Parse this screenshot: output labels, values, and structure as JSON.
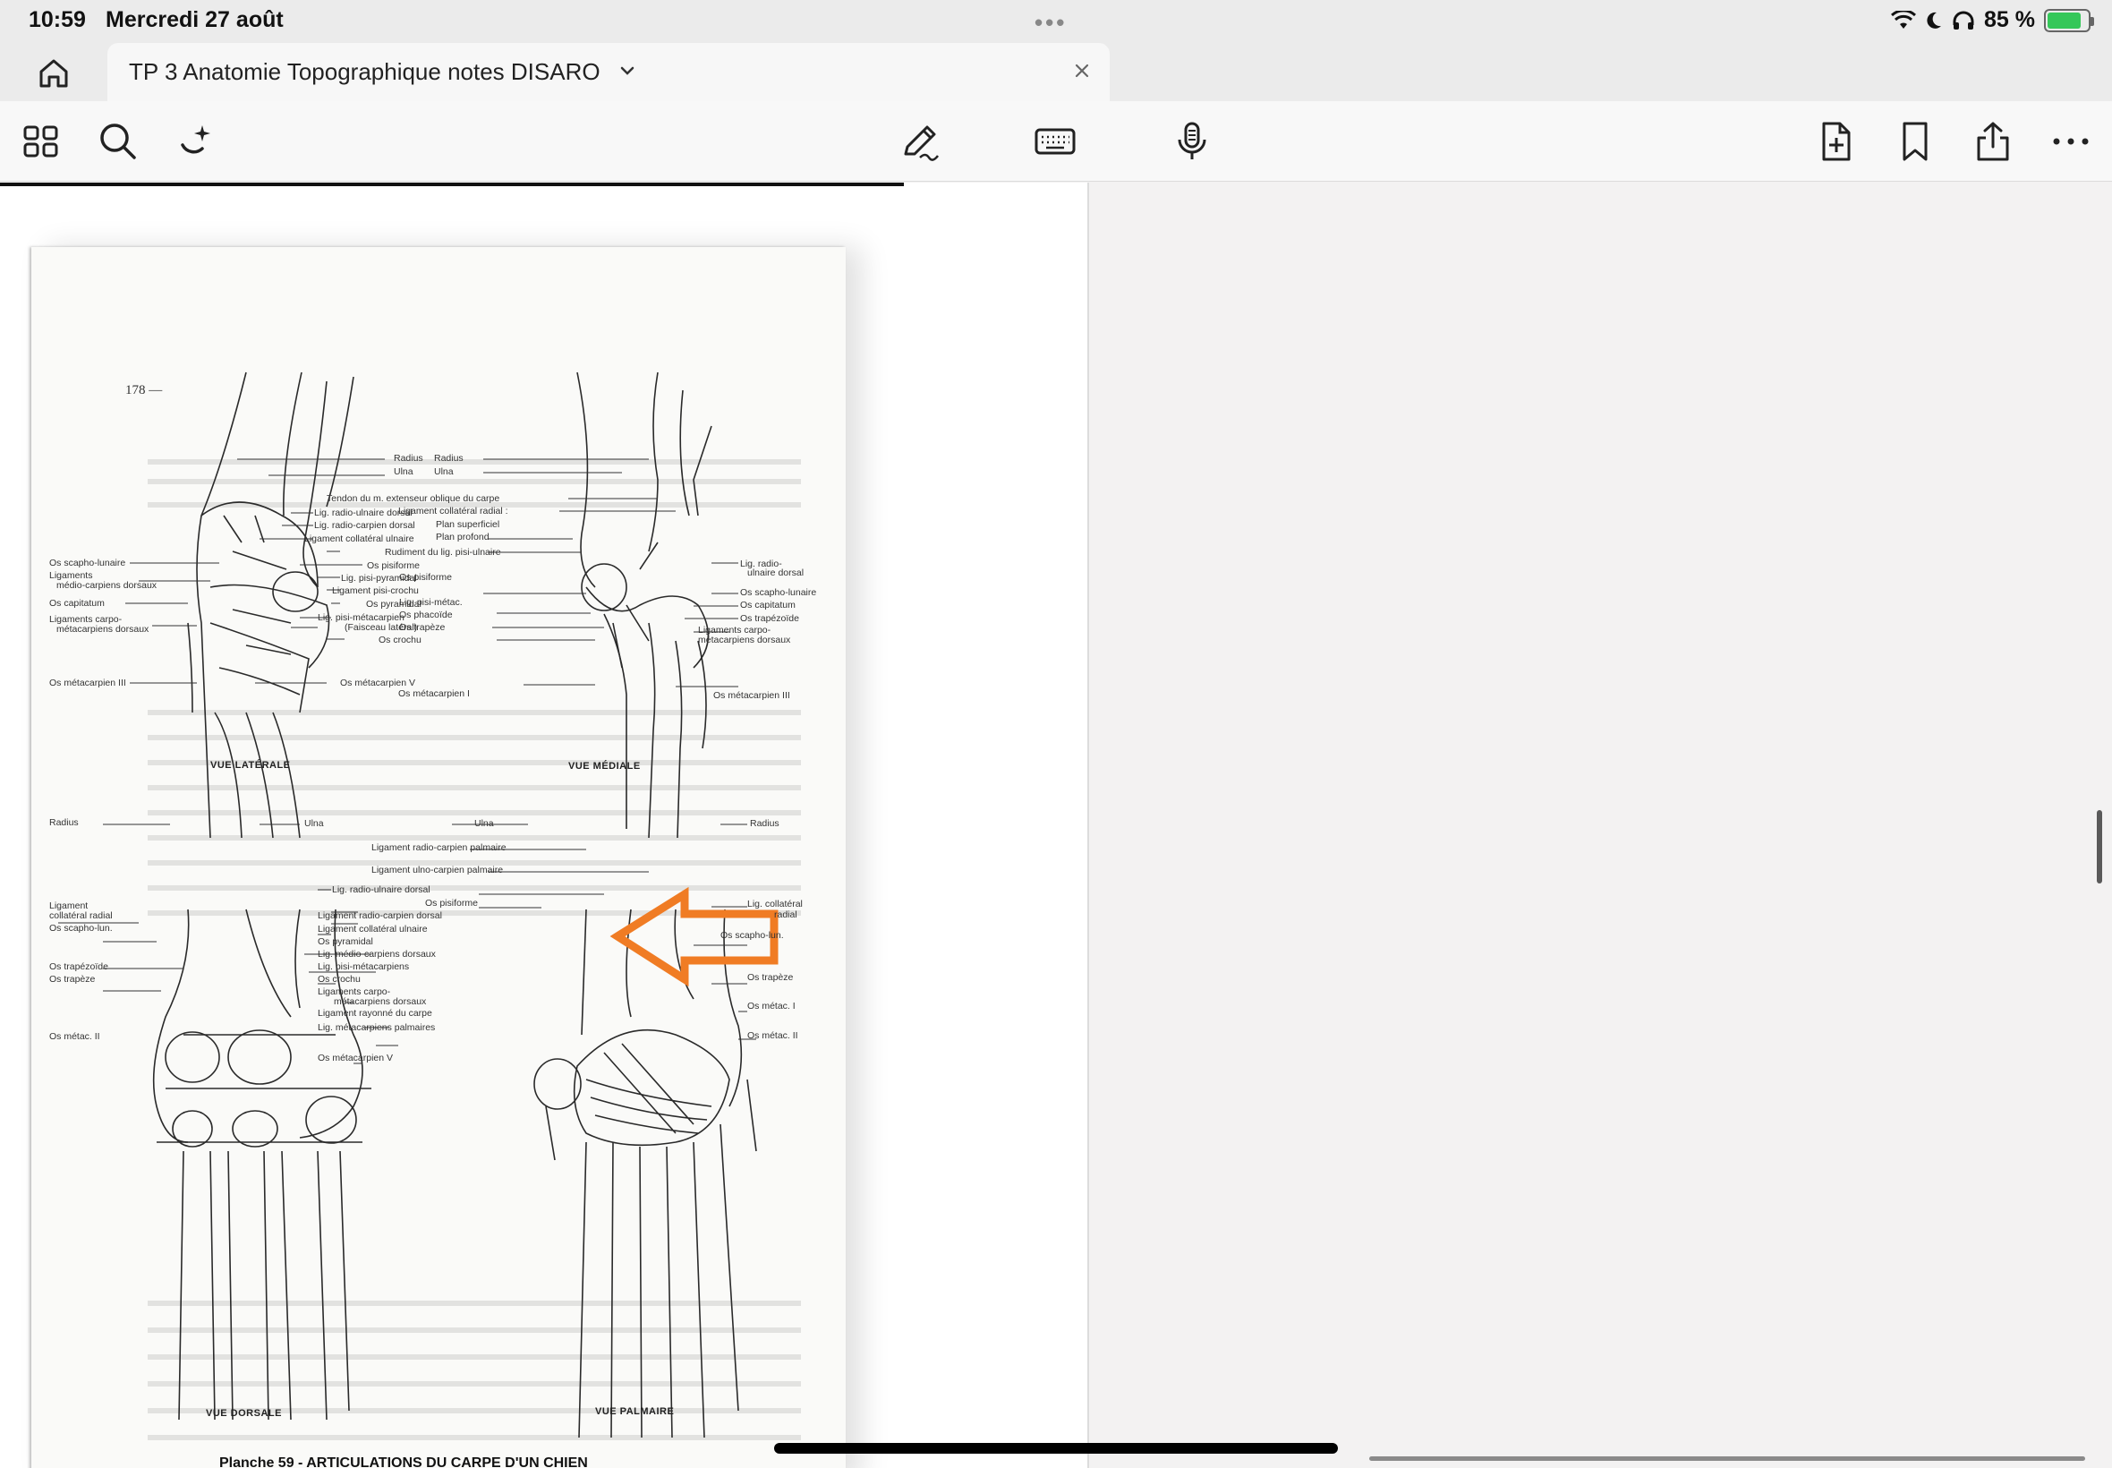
{
  "status_bar": {
    "time": "10:59",
    "date": "Mercredi 27 août",
    "battery": "85 %",
    "battery_level": 0.85,
    "icons": [
      "wifi-icon",
      "moon-icon",
      "headphones-icon",
      "battery-charging-icon"
    ]
  },
  "tab": {
    "title": "TP 3 Anatomie Topographique notes DISARO"
  },
  "toolbar": {
    "left_icons": [
      "grid-icon",
      "search-icon",
      "ai-assistant-icon"
    ],
    "center_icons": [
      "pen-icon",
      "keyboard-icon",
      "microphone-icon"
    ],
    "right_icons": [
      "add-page-icon",
      "bookmark-icon",
      "share-icon",
      "more-icon"
    ]
  },
  "page": {
    "number": "178 —",
    "captions": {
      "lateral": "VUE LATÉRALE",
      "medial": "VUE MÉDIALE",
      "dorsal": "VUE DORSALE",
      "palmar": "VUE PALMAIRE"
    },
    "plate_caption": "Planche 59 - ARTICULATIONS DU CARPE D'UN CHIEN",
    "labels": {
      "tl": [
        "Radius",
        "Ulna",
        "Lig. radio-ulnaire dorsal",
        "Lig. radio-carpien dorsal",
        "Ligament collatéral ulnaire",
        "Rudiment du lig. pisi-ulnaire",
        "Os pisiforme",
        "Lig. pisi-pyramidal",
        "Ligament pisi-crochu",
        "Os pyramidal",
        "Lig. pisi-métacarpien",
        "(Faisceau latéral)",
        "Os crochu",
        "Os métacarpien V"
      ],
      "tl_left": [
        "Os scapho-lunaire",
        "Ligaments",
        "médio-carpiens dorsaux",
        "Os capitatum",
        "Ligaments carpo-",
        "métacarpiens dorsaux",
        "Os métacarpien III"
      ],
      "tr": [
        "Radius",
        "Ulna",
        "Tendon du m. extenseur oblique du carpe",
        "Ligament collatéral radial :",
        "Plan superficiel",
        "Plan profond",
        "Os pisiforme",
        "Lig. pisi-métac.",
        "Os phacoïde",
        "Os trapèze",
        "Os métacarpien I"
      ],
      "tr_right": [
        "Lig. radio-",
        "ulnaire dorsal",
        "Os scapho-lunaire",
        "Os capitatum",
        "Os trapézoïde",
        "Ligaments carpo-",
        "métacarpiens dorsaux",
        "Os métacarpien III"
      ],
      "bl_left": [
        "Radius",
        "Ligament",
        "collatéral radial",
        "Os scapho-lun.",
        "Os trapézoïde",
        "Os trapèze",
        "Os métac. II"
      ],
      "bl_mid": [
        "Ulna",
        "Lig. radio-ulnaire dorsal",
        "Ligament radio-carpien dorsal",
        "Ligament collatéral ulnaire",
        "Os pyramidal",
        "Lig. médio-carpiens dorsaux",
        "Lig. pisi-métacarpiens",
        "Os crochu",
        "Ligaments carpo-",
        "métacarpiens dorsaux",
        "Ligament rayonné du carpe",
        "Lig. métacarpiens palmaires",
        "Os métacarpien V"
      ],
      "br_left": [
        "Ulna",
        "Ligament radio-carpien palmaire",
        "Ligament ulno-carpien palmaire",
        "Os pisiforme"
      ],
      "br_right": [
        "Radius",
        "Lig. collatéral",
        "radial",
        "Os scapho-lun.",
        "Os trapèze",
        "Os métac. I",
        "Os métac. II"
      ]
    },
    "annotation_color": "#f07c24"
  },
  "colors": {
    "accent_battery": "#35c759",
    "annotation_arrow": "#f07c24"
  }
}
